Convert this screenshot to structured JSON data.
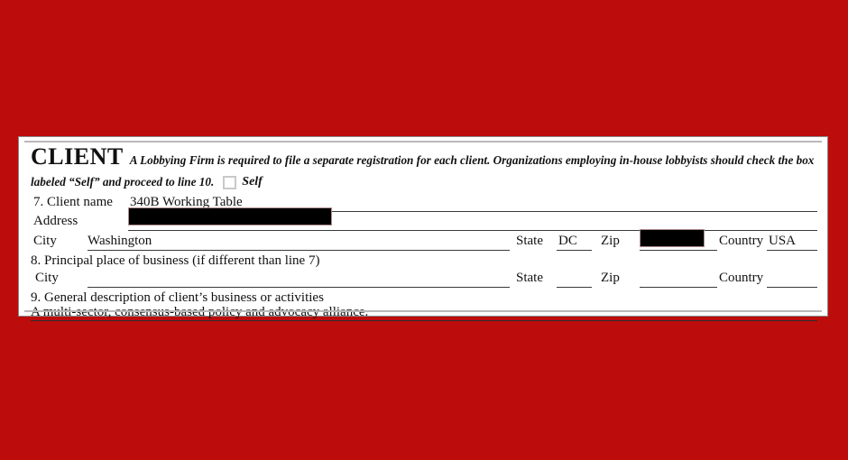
{
  "page": {
    "background_color": "#bd0c0c",
    "sheet_color": "#ffffff"
  },
  "form": {
    "section_title": "CLIENT",
    "instruction_line_1": "A Lobbying Firm is required to file a separate registration for each client. Organizations employing in-house lobbyists should check the box",
    "instruction_line_2": "labeled “Self” and proceed to line 10.",
    "self_checkbox_label": "Self",
    "self_checkbox_checked": false,
    "line7": {
      "label": "7. Client name",
      "value": "340B Working Table"
    },
    "address": {
      "label": "Address",
      "value": "",
      "redacted": true
    },
    "city_row": {
      "city_label": "City",
      "city_value": "Washington",
      "state_label": "State",
      "state_value": "DC",
      "zip_label": "Zip",
      "zip_value": "",
      "zip_redacted": true,
      "country_label": "Country",
      "country_value": "USA"
    },
    "line8": {
      "label": "8. Principal place of business (if different than line 7)",
      "city_label": "City",
      "city_value": "",
      "state_label": "State",
      "state_value": "",
      "zip_label": "Zip",
      "zip_value": "",
      "country_label": "Country",
      "country_value": ""
    },
    "line9": {
      "label": "9. General description of client’s business or activities",
      "value": "A multi-sector, consensus-based policy and advocacy alliance."
    }
  }
}
